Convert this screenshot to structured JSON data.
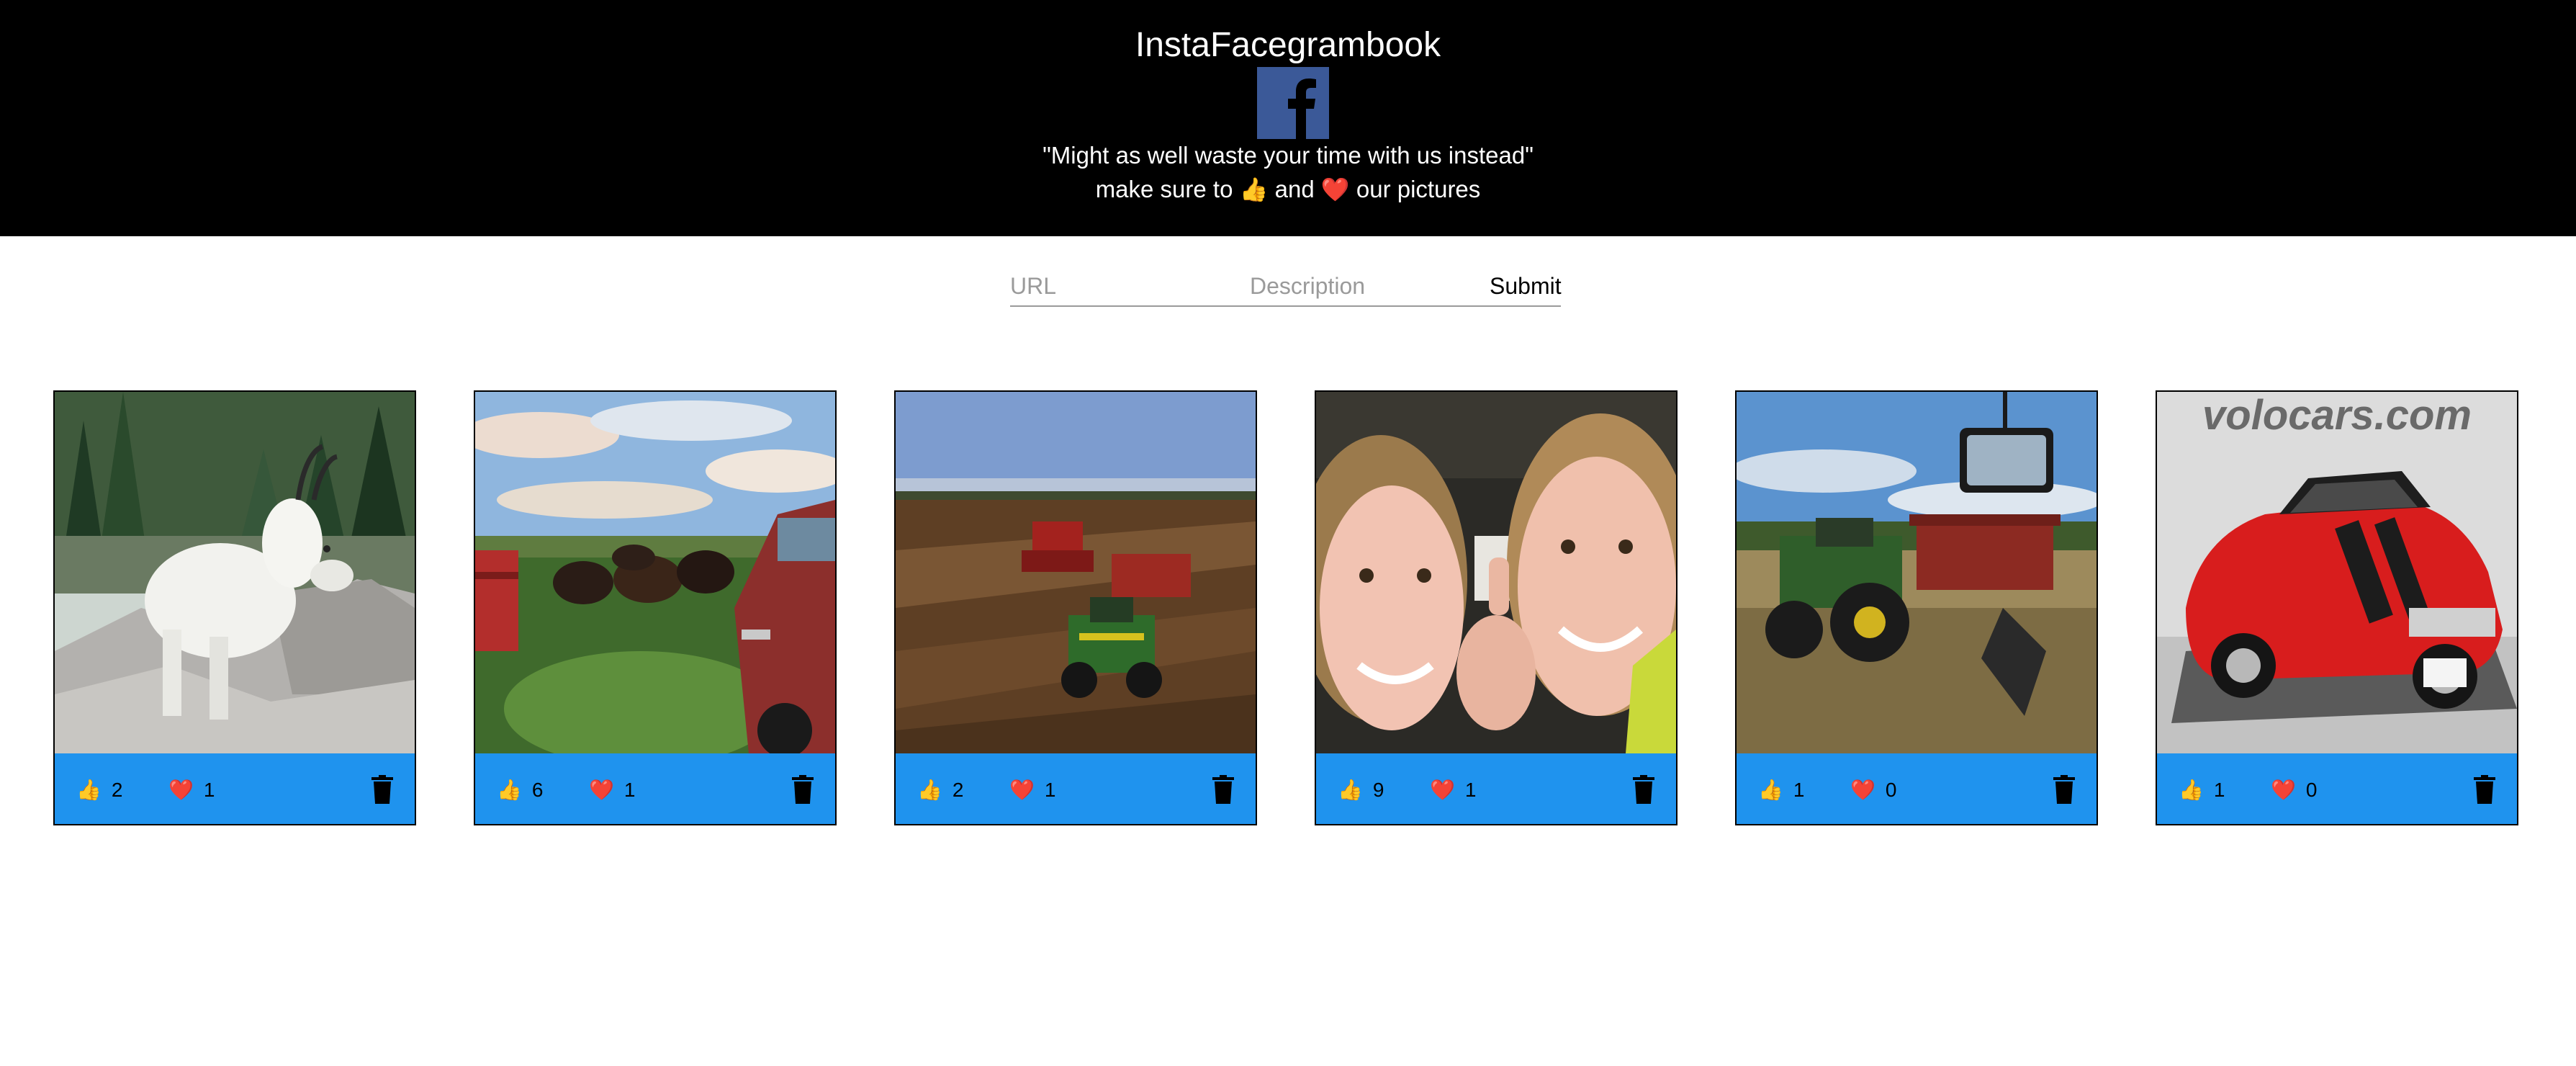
{
  "header": {
    "title": "InstaFacegrambook",
    "logo_icon": "facebook-logo",
    "tagline": "\"Might as well waste your time with us instead\"",
    "subline_prefix": "make sure to",
    "subline_like_emoji": "👍",
    "subline_and": "and",
    "subline_heart_emoji": "❤️",
    "subline_suffix": "our pictures"
  },
  "form": {
    "url_placeholder": "URL",
    "url_value": "",
    "description_placeholder": "Description",
    "description_value": "",
    "submit_label": "Submit"
  },
  "icons": {
    "like": "👍",
    "heart": "❤️",
    "delete": "trash-icon"
  },
  "colors": {
    "header_bg": "#000000",
    "card_bar": "#1f93ee",
    "fb_blue": "#3b5998"
  },
  "posts": [
    {
      "subject": "mountain goat",
      "likes": "2",
      "hearts": "1"
    },
    {
      "subject": "cattle by red truck",
      "likes": "6",
      "hearts": "1"
    },
    {
      "subject": "combine harvesting field",
      "likes": "2",
      "hearts": "1"
    },
    {
      "subject": "two smiling kids",
      "likes": "9",
      "hearts": "1"
    },
    {
      "subject": "green tractor with grain cart",
      "likes": "1",
      "hearts": "0"
    },
    {
      "subject": "red muscle car",
      "likes": "1",
      "hearts": "0",
      "watermark": "volocars.com"
    }
  ]
}
